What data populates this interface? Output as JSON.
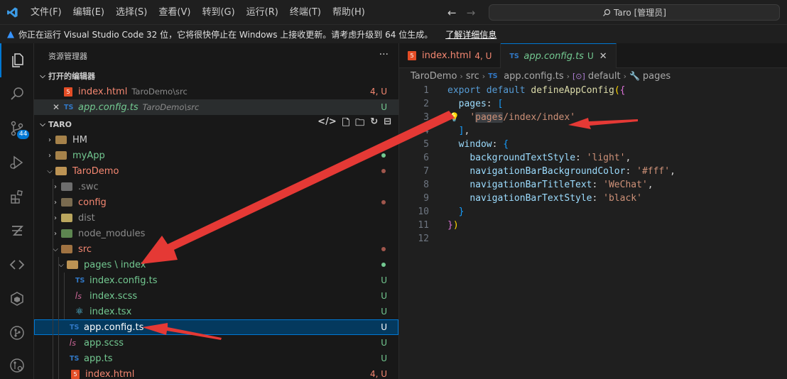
{
  "menu": [
    "文件(F)",
    "编辑(E)",
    "选择(S)",
    "查看(V)",
    "转到(G)",
    "运行(R)",
    "终端(T)",
    "帮助(H)"
  ],
  "search": {
    "text": "Taro [管理员]"
  },
  "notice": {
    "text": "你正在运行 Visual Studio Code 32 位，它将很快停止在 Windows 上接收更新。请考虑升级到 64 位生成。",
    "link": "了解详细信息"
  },
  "activity": {
    "scm_badge": "44"
  },
  "sidebar": {
    "title": "资源管理器",
    "open_editors_title": "打开的编辑器",
    "open_editors": [
      {
        "name": "index.html",
        "path": "TaroDemo\\src",
        "status": "4, U"
      },
      {
        "name": "app.config.ts",
        "path": "TaroDemo\\src",
        "status": "U"
      }
    ],
    "project_title": "TARO",
    "tree": [
      {
        "name": "HM"
      },
      {
        "name": "myApp"
      },
      {
        "name": "TaroDemo"
      },
      {
        "name": ".swc"
      },
      {
        "name": "config"
      },
      {
        "name": "dist"
      },
      {
        "name": "node_modules"
      },
      {
        "name": "src"
      },
      {
        "name": "pages \\ index"
      },
      {
        "name": "index.config.ts",
        "status": "U"
      },
      {
        "name": "index.scss",
        "status": "U"
      },
      {
        "name": "index.tsx",
        "status": "U"
      },
      {
        "name": "app.config.ts",
        "status": "U"
      },
      {
        "name": "app.scss",
        "status": "U"
      },
      {
        "name": "app.ts",
        "status": "U"
      },
      {
        "name": "index.html",
        "status": "4, U"
      }
    ]
  },
  "tabs": [
    {
      "name": "index.html",
      "status": "4, U"
    },
    {
      "name": "app.config.ts",
      "status": "U"
    }
  ],
  "breadcrumb": [
    "TaroDemo",
    "src",
    "app.config.ts",
    "default",
    "pages"
  ],
  "code_lines": [
    "1",
    "2",
    "3",
    "4",
    "5",
    "6",
    "7",
    "8",
    "9",
    "10",
    "11",
    "12"
  ],
  "colors": {
    "accent": "#0078d4",
    "untracked": "#73c991",
    "modified": "#f48771",
    "arrow": "#e53935"
  }
}
